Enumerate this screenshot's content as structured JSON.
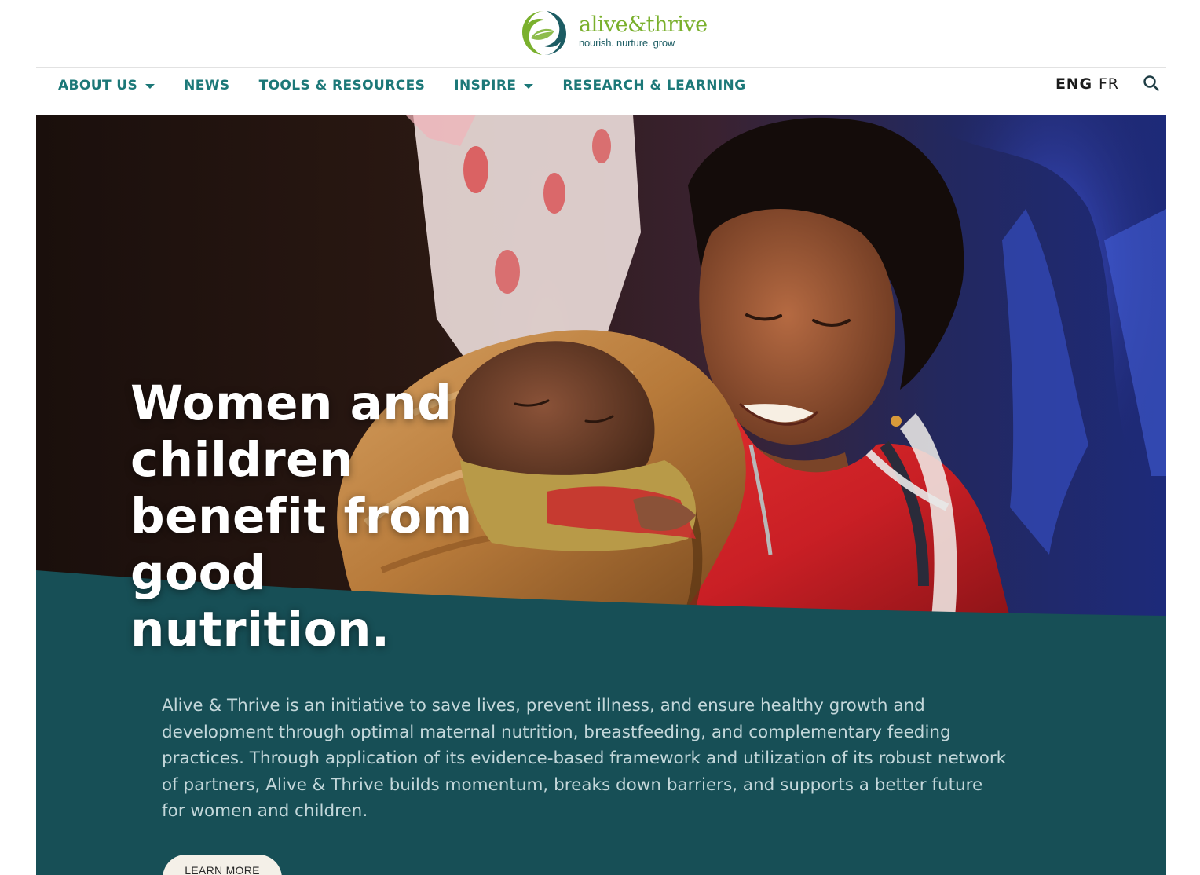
{
  "header": {
    "logo": {
      "name": "alive&thrive",
      "tagline": "nourish. nurture. grow",
      "icon": "alive-thrive-leaf-logo"
    },
    "nav": [
      {
        "label": "ABOUT US",
        "has_dropdown": true
      },
      {
        "label": "NEWS",
        "has_dropdown": false
      },
      {
        "label": "TOOLS & RESOURCES",
        "has_dropdown": false
      },
      {
        "label": "INSPIRE",
        "has_dropdown": true
      },
      {
        "label": "RESEARCH & LEARNING",
        "has_dropdown": false
      }
    ],
    "languages": [
      {
        "label": "ENG",
        "active": true
      },
      {
        "label": "FR",
        "active": false
      }
    ],
    "search_icon": "search-icon"
  },
  "hero": {
    "title": "Women and children benefit from good nutrition.",
    "description": "Alive & Thrive is an initiative to save lives, prevent illness, and ensure healthy growth and development through optimal maternal nutrition, breastfeeding, and complementary feeding practices. Through application of its evidence-based framework and utilization of its robust network of partners, Alive & Thrive builds momentum, breaks down barriers, and supports a better future for women and children.",
    "cta_label": "LEARN MORE",
    "image": "mother-holding-newborn-photo"
  },
  "colors": {
    "brand_teal": "#1c7878",
    "hero_band": "#174f56",
    "logo_green": "#7ab02d",
    "logo_navy": "#1c5c63",
    "body_text_light": "#c3d7da",
    "cta_bg": "#f4f0e8"
  }
}
